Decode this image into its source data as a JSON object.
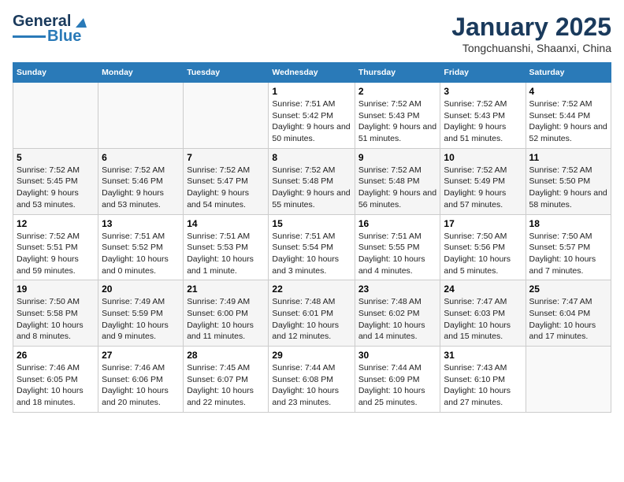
{
  "header": {
    "logo_line1": "General",
    "logo_line2": "Blue",
    "month_title": "January 2025",
    "location": "Tongchuanshi, Shaanxi, China"
  },
  "days_of_week": [
    "Sunday",
    "Monday",
    "Tuesday",
    "Wednesday",
    "Thursday",
    "Friday",
    "Saturday"
  ],
  "weeks": [
    [
      {
        "day": "",
        "info": ""
      },
      {
        "day": "",
        "info": ""
      },
      {
        "day": "",
        "info": ""
      },
      {
        "day": "1",
        "info": "Sunrise: 7:51 AM\nSunset: 5:42 PM\nDaylight: 9 hours and 50 minutes."
      },
      {
        "day": "2",
        "info": "Sunrise: 7:52 AM\nSunset: 5:43 PM\nDaylight: 9 hours and 51 minutes."
      },
      {
        "day": "3",
        "info": "Sunrise: 7:52 AM\nSunset: 5:43 PM\nDaylight: 9 hours and 51 minutes."
      },
      {
        "day": "4",
        "info": "Sunrise: 7:52 AM\nSunset: 5:44 PM\nDaylight: 9 hours and 52 minutes."
      }
    ],
    [
      {
        "day": "5",
        "info": "Sunrise: 7:52 AM\nSunset: 5:45 PM\nDaylight: 9 hours and 53 minutes."
      },
      {
        "day": "6",
        "info": "Sunrise: 7:52 AM\nSunset: 5:46 PM\nDaylight: 9 hours and 53 minutes."
      },
      {
        "day": "7",
        "info": "Sunrise: 7:52 AM\nSunset: 5:47 PM\nDaylight: 9 hours and 54 minutes."
      },
      {
        "day": "8",
        "info": "Sunrise: 7:52 AM\nSunset: 5:48 PM\nDaylight: 9 hours and 55 minutes."
      },
      {
        "day": "9",
        "info": "Sunrise: 7:52 AM\nSunset: 5:48 PM\nDaylight: 9 hours and 56 minutes."
      },
      {
        "day": "10",
        "info": "Sunrise: 7:52 AM\nSunset: 5:49 PM\nDaylight: 9 hours and 57 minutes."
      },
      {
        "day": "11",
        "info": "Sunrise: 7:52 AM\nSunset: 5:50 PM\nDaylight: 9 hours and 58 minutes."
      }
    ],
    [
      {
        "day": "12",
        "info": "Sunrise: 7:52 AM\nSunset: 5:51 PM\nDaylight: 9 hours and 59 minutes."
      },
      {
        "day": "13",
        "info": "Sunrise: 7:51 AM\nSunset: 5:52 PM\nDaylight: 10 hours and 0 minutes."
      },
      {
        "day": "14",
        "info": "Sunrise: 7:51 AM\nSunset: 5:53 PM\nDaylight: 10 hours and 1 minute."
      },
      {
        "day": "15",
        "info": "Sunrise: 7:51 AM\nSunset: 5:54 PM\nDaylight: 10 hours and 3 minutes."
      },
      {
        "day": "16",
        "info": "Sunrise: 7:51 AM\nSunset: 5:55 PM\nDaylight: 10 hours and 4 minutes."
      },
      {
        "day": "17",
        "info": "Sunrise: 7:50 AM\nSunset: 5:56 PM\nDaylight: 10 hours and 5 minutes."
      },
      {
        "day": "18",
        "info": "Sunrise: 7:50 AM\nSunset: 5:57 PM\nDaylight: 10 hours and 7 minutes."
      }
    ],
    [
      {
        "day": "19",
        "info": "Sunrise: 7:50 AM\nSunset: 5:58 PM\nDaylight: 10 hours and 8 minutes."
      },
      {
        "day": "20",
        "info": "Sunrise: 7:49 AM\nSunset: 5:59 PM\nDaylight: 10 hours and 9 minutes."
      },
      {
        "day": "21",
        "info": "Sunrise: 7:49 AM\nSunset: 6:00 PM\nDaylight: 10 hours and 11 minutes."
      },
      {
        "day": "22",
        "info": "Sunrise: 7:48 AM\nSunset: 6:01 PM\nDaylight: 10 hours and 12 minutes."
      },
      {
        "day": "23",
        "info": "Sunrise: 7:48 AM\nSunset: 6:02 PM\nDaylight: 10 hours and 14 minutes."
      },
      {
        "day": "24",
        "info": "Sunrise: 7:47 AM\nSunset: 6:03 PM\nDaylight: 10 hours and 15 minutes."
      },
      {
        "day": "25",
        "info": "Sunrise: 7:47 AM\nSunset: 6:04 PM\nDaylight: 10 hours and 17 minutes."
      }
    ],
    [
      {
        "day": "26",
        "info": "Sunrise: 7:46 AM\nSunset: 6:05 PM\nDaylight: 10 hours and 18 minutes."
      },
      {
        "day": "27",
        "info": "Sunrise: 7:46 AM\nSunset: 6:06 PM\nDaylight: 10 hours and 20 minutes."
      },
      {
        "day": "28",
        "info": "Sunrise: 7:45 AM\nSunset: 6:07 PM\nDaylight: 10 hours and 22 minutes."
      },
      {
        "day": "29",
        "info": "Sunrise: 7:44 AM\nSunset: 6:08 PM\nDaylight: 10 hours and 23 minutes."
      },
      {
        "day": "30",
        "info": "Sunrise: 7:44 AM\nSunset: 6:09 PM\nDaylight: 10 hours and 25 minutes."
      },
      {
        "day": "31",
        "info": "Sunrise: 7:43 AM\nSunset: 6:10 PM\nDaylight: 10 hours and 27 minutes."
      },
      {
        "day": "",
        "info": ""
      }
    ]
  ]
}
